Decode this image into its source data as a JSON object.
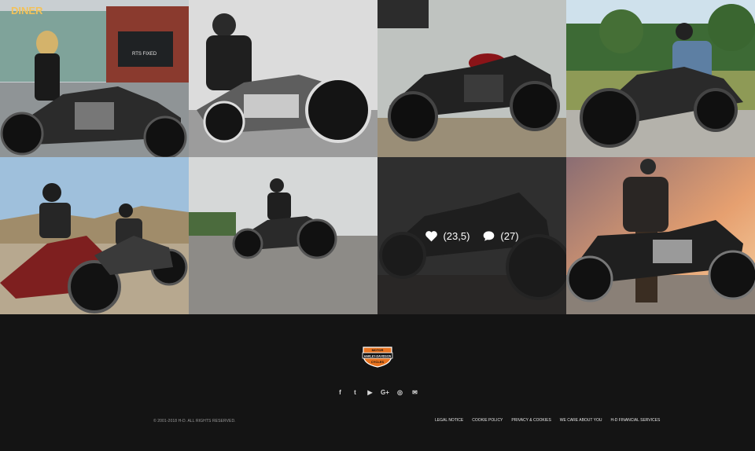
{
  "gallery": {
    "tiles": [
      {
        "caption": ""
      },
      {
        "caption": ""
      },
      {
        "caption": ""
      },
      {
        "caption": ""
      },
      {
        "caption": ""
      },
      {
        "caption": ""
      },
      {
        "caption": ""
      },
      {
        "caption": ""
      }
    ],
    "hovered_tile": {
      "likes": "(23,5)",
      "comments": "(27)",
      "like_icon": "heart-icon",
      "comment_icon": "speech-bubble-icon"
    },
    "scene_text": {
      "diner_sign": "DINER",
      "shop_sign": "RTS FIXED"
    }
  },
  "footer": {
    "logo": {
      "top": "MOTOR",
      "middle": "HARLEY-DAVIDSON",
      "bottom": "CYCLES",
      "colors": {
        "orange": "#e8731f",
        "black": "#111111",
        "white": "#ffffff"
      }
    },
    "social": [
      {
        "icon": "facebook-icon",
        "glyph": "f"
      },
      {
        "icon": "twitter-icon",
        "glyph": "t"
      },
      {
        "icon": "youtube-icon",
        "glyph": "▶"
      },
      {
        "icon": "google-plus-icon",
        "glyph": "G+"
      },
      {
        "icon": "instagram-icon",
        "glyph": "◎"
      },
      {
        "icon": "email-icon",
        "glyph": "✉"
      }
    ],
    "copyright": "© 2001-2018 H-D. ALL RIGHTS RESERVED.",
    "links": [
      "LEGAL NOTICE",
      "COOKIE POLICY",
      "PRIVACY & COOKIES",
      "WE CARE ABOUT YOU",
      "H-D FINANCIAL SERVICES"
    ]
  },
  "colors": {
    "background": "#141414",
    "link": "#e6e6e6",
    "muted": "#9a9a9a"
  }
}
